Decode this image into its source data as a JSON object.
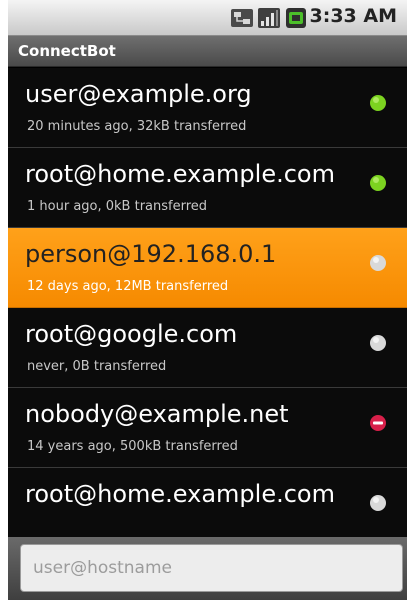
{
  "status_bar": {
    "time": "3:33 AM",
    "icons": [
      "network-icon",
      "signal-strength-icon",
      "battery-icon"
    ]
  },
  "app": {
    "title": "ConnectBot"
  },
  "hosts": [
    {
      "name": "user@example.org",
      "status": "20 minutes ago, 32kB transferred",
      "state": "connected",
      "state_color": "#7cd320"
    },
    {
      "name": "root@home.example.com",
      "status": "1 hour ago, 0kB transferred",
      "state": "connected",
      "state_color": "#7cd320"
    },
    {
      "name": "person@192.168.0.1",
      "status": "12 days ago, 12MB transferred",
      "state": "disconnected",
      "state_color": "#d9d9d9",
      "selected": true
    },
    {
      "name": "root@google.com",
      "status": "never, 0B transferred",
      "state": "disconnected",
      "state_color": "#d9d9d9"
    },
    {
      "name": "nobody@example.net",
      "status": "14 years ago, 500kB transferred",
      "state": "error",
      "state_color": "#d8204a"
    },
    {
      "name": "root@home.example.com",
      "status": "",
      "state": "disconnected",
      "state_color": "#d9d9d9"
    }
  ],
  "quick_connect": {
    "placeholder": "user@hostname",
    "value": ""
  },
  "colors": {
    "selected_highlight": "#f68a00",
    "list_background": "#0b0b0b",
    "connected": "#7cd320",
    "error": "#d8204a"
  }
}
